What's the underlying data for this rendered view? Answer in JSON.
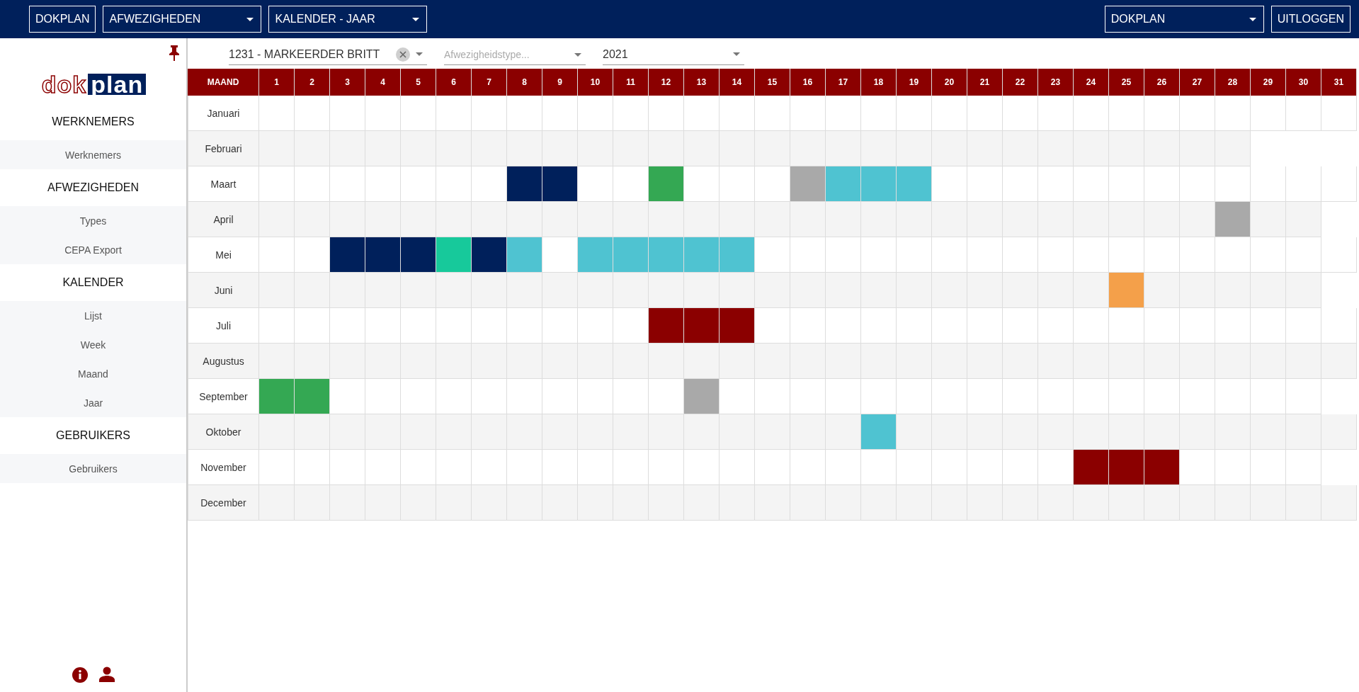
{
  "topbar": {
    "home_button": "DOKPLAN",
    "module_select": "AFWEZIGHEDEN",
    "view_select": "KALENDER - JAAR",
    "company_select": "DOKPLAN",
    "logout_button": "UITLOGGEN"
  },
  "sidebar": {
    "logo": {
      "part_1": "dok",
      "part_2": "plan"
    },
    "sections": [
      {
        "title": "WERKNEMERS",
        "items": [
          "Werknemers"
        ]
      },
      {
        "title": "AFWEZIGHEDEN",
        "items": [
          "Types",
          "CEPA Export"
        ]
      },
      {
        "title": "KALENDER",
        "items": [
          "Lijst",
          "Week",
          "Maand",
          "Jaar"
        ]
      },
      {
        "title": "GEBRUIKERS",
        "items": [
          "Gebruikers"
        ]
      }
    ]
  },
  "filters": {
    "employee": "1231 - MARKEERDER BRITT",
    "absence_type": {
      "placeholder": "Afwezigheidstype..."
    },
    "year": "2021"
  },
  "calendar": {
    "columns": [
      "MAAND",
      "1",
      "2",
      "3",
      "4",
      "5",
      "6",
      "7",
      "8",
      "9",
      "10",
      "11",
      "12",
      "13",
      "14",
      "15",
      "16",
      "17",
      "18",
      "19",
      "20",
      "21",
      "22",
      "23",
      "24",
      "25",
      "26",
      "27",
      "28",
      "29",
      "30",
      "31"
    ],
    "months": [
      {
        "name": "Januari",
        "days": [
          {
            "absent": false
          },
          {
            "absent": false
          },
          {
            "absent": false
          },
          {
            "absent": false
          },
          {
            "absent": false
          },
          {
            "absent": false
          },
          {
            "absent": false
          },
          {
            "absent": false
          },
          {
            "absent": false
          },
          {
            "absent": false
          },
          {
            "absent": false
          },
          {
            "absent": false
          },
          {
            "absent": false
          },
          {
            "absent": false
          },
          {
            "absent": false
          },
          {
            "absent": false
          },
          {
            "absent": false
          },
          {
            "absent": false
          },
          {
            "absent": false
          },
          {
            "absent": false
          },
          {
            "absent": false
          },
          {
            "absent": false
          },
          {
            "absent": false
          },
          {
            "absent": false
          },
          {
            "absent": false
          },
          {
            "absent": false
          },
          {
            "absent": false
          },
          {
            "absent": false
          },
          {
            "absent": false
          },
          {
            "absent": false
          },
          {
            "absent": false
          }
        ]
      },
      {
        "name": "Februari",
        "days": [
          {
            "absent": false
          },
          {
            "absent": false
          },
          {
            "absent": false
          },
          {
            "absent": false
          },
          {
            "absent": false
          },
          {
            "absent": false
          },
          {
            "absent": false
          },
          {
            "absent": false
          },
          {
            "absent": false
          },
          {
            "absent": false
          },
          {
            "absent": false
          },
          {
            "absent": false
          },
          {
            "absent": false
          },
          {
            "absent": false
          },
          {
            "absent": false
          },
          {
            "absent": false
          },
          {
            "absent": false
          },
          {
            "absent": false
          },
          {
            "absent": false
          },
          {
            "absent": false
          },
          {
            "absent": false
          },
          {
            "absent": false
          },
          {
            "absent": false
          },
          {
            "absent": false
          },
          {
            "absent": false
          },
          {
            "absent": false
          },
          {
            "absent": false
          },
          {
            "absent": false
          }
        ]
      },
      {
        "name": "Maart",
        "days": [
          {
            "absent": false
          },
          {
            "absent": false
          },
          {
            "absent": false
          },
          {
            "absent": false
          },
          {
            "absent": false
          },
          {
            "absent": false
          },
          {
            "absent": false
          },
          {
            "absent": true,
            "color": "#00205b"
          },
          {
            "absent": true,
            "color": "#00205b"
          },
          {
            "absent": false
          },
          {
            "absent": false
          },
          {
            "absent": true,
            "color": "#34a853"
          },
          {
            "absent": false
          },
          {
            "absent": false
          },
          {
            "absent": false
          },
          {
            "absent": true,
            "color": "#a9a9a9"
          },
          {
            "absent": true,
            "color": "#4fc3d1"
          },
          {
            "absent": true,
            "color": "#4fc3d1"
          },
          {
            "absent": true,
            "color": "#4fc3d1"
          },
          {
            "absent": false
          },
          {
            "absent": false
          },
          {
            "absent": false
          },
          {
            "absent": false
          },
          {
            "absent": false
          },
          {
            "absent": false
          },
          {
            "absent": false
          },
          {
            "absent": false
          },
          {
            "absent": false
          },
          {
            "absent": false
          },
          {
            "absent": false
          },
          {
            "absent": false
          }
        ]
      },
      {
        "name": "April",
        "days": [
          {
            "absent": false
          },
          {
            "absent": false
          },
          {
            "absent": false
          },
          {
            "absent": false
          },
          {
            "absent": false
          },
          {
            "absent": false
          },
          {
            "absent": false
          },
          {
            "absent": false
          },
          {
            "absent": false
          },
          {
            "absent": false
          },
          {
            "absent": false
          },
          {
            "absent": false
          },
          {
            "absent": false
          },
          {
            "absent": false
          },
          {
            "absent": false
          },
          {
            "absent": false
          },
          {
            "absent": false
          },
          {
            "absent": false
          },
          {
            "absent": false
          },
          {
            "absent": false
          },
          {
            "absent": false
          },
          {
            "absent": false
          },
          {
            "absent": false
          },
          {
            "absent": false
          },
          {
            "absent": false
          },
          {
            "absent": false
          },
          {
            "absent": false
          },
          {
            "absent": true,
            "color": "#a9a9a9"
          },
          {
            "absent": false
          },
          {
            "absent": false
          }
        ]
      },
      {
        "name": "Mei",
        "days": [
          {
            "absent": false
          },
          {
            "absent": false
          },
          {
            "absent": true,
            "color": "#00205b"
          },
          {
            "absent": true,
            "color": "#00205b"
          },
          {
            "absent": true,
            "color": "#00205b"
          },
          {
            "absent": true,
            "color": "#17c99b"
          },
          {
            "absent": true,
            "color": "#00205b"
          },
          {
            "absent": true,
            "color": "#4fc3d1"
          },
          {
            "absent": false
          },
          {
            "absent": true,
            "color": "#4fc3d1"
          },
          {
            "absent": true,
            "color": "#4fc3d1"
          },
          {
            "absent": true,
            "color": "#4fc3d1"
          },
          {
            "absent": true,
            "color": "#4fc3d1"
          },
          {
            "absent": true,
            "color": "#4fc3d1"
          },
          {
            "absent": false
          },
          {
            "absent": false
          },
          {
            "absent": false
          },
          {
            "absent": false
          },
          {
            "absent": false
          },
          {
            "absent": false
          },
          {
            "absent": false
          },
          {
            "absent": false
          },
          {
            "absent": false
          },
          {
            "absent": false
          },
          {
            "absent": false
          },
          {
            "absent": false
          },
          {
            "absent": false
          },
          {
            "absent": false
          },
          {
            "absent": false
          },
          {
            "absent": false
          },
          {
            "absent": false
          }
        ]
      },
      {
        "name": "Juni",
        "days": [
          {
            "absent": false
          },
          {
            "absent": false
          },
          {
            "absent": false
          },
          {
            "absent": false
          },
          {
            "absent": false
          },
          {
            "absent": false
          },
          {
            "absent": false
          },
          {
            "absent": false
          },
          {
            "absent": false
          },
          {
            "absent": false
          },
          {
            "absent": false
          },
          {
            "absent": false
          },
          {
            "absent": false
          },
          {
            "absent": false
          },
          {
            "absent": false
          },
          {
            "absent": false
          },
          {
            "absent": false
          },
          {
            "absent": false
          },
          {
            "absent": false
          },
          {
            "absent": false
          },
          {
            "absent": false
          },
          {
            "absent": false
          },
          {
            "absent": false
          },
          {
            "absent": false
          },
          {
            "absent": true,
            "color": "#f4a04a"
          },
          {
            "absent": false
          },
          {
            "absent": false
          },
          {
            "absent": false
          },
          {
            "absent": false
          },
          {
            "absent": false
          }
        ]
      },
      {
        "name": "Juli",
        "days": [
          {
            "absent": false
          },
          {
            "absent": false
          },
          {
            "absent": false
          },
          {
            "absent": false
          },
          {
            "absent": false
          },
          {
            "absent": false
          },
          {
            "absent": false
          },
          {
            "absent": false
          },
          {
            "absent": false
          },
          {
            "absent": false
          },
          {
            "absent": false
          },
          {
            "absent": true,
            "color": "#8b0000"
          },
          {
            "absent": true,
            "color": "#8b0000"
          },
          {
            "absent": true,
            "color": "#8b0000"
          },
          {
            "absent": false
          },
          {
            "absent": false
          },
          {
            "absent": false
          },
          {
            "absent": false
          },
          {
            "absent": false
          },
          {
            "absent": false
          },
          {
            "absent": false
          },
          {
            "absent": false
          },
          {
            "absent": false
          },
          {
            "absent": false
          },
          {
            "absent": false
          },
          {
            "absent": false
          },
          {
            "absent": false
          },
          {
            "absent": false
          },
          {
            "absent": false
          },
          {
            "absent": false
          },
          {
            "absent": false
          }
        ]
      },
      {
        "name": "Augustus",
        "days": [
          {
            "absent": false
          },
          {
            "absent": false
          },
          {
            "absent": false
          },
          {
            "absent": false
          },
          {
            "absent": false
          },
          {
            "absent": false
          },
          {
            "absent": false
          },
          {
            "absent": false
          },
          {
            "absent": false
          },
          {
            "absent": false
          },
          {
            "absent": false
          },
          {
            "absent": false
          },
          {
            "absent": false
          },
          {
            "absent": false
          },
          {
            "absent": false
          },
          {
            "absent": false
          },
          {
            "absent": false
          },
          {
            "absent": false
          },
          {
            "absent": false
          },
          {
            "absent": false
          },
          {
            "absent": false
          },
          {
            "absent": false
          },
          {
            "absent": false
          },
          {
            "absent": false
          },
          {
            "absent": false
          },
          {
            "absent": false
          },
          {
            "absent": false
          },
          {
            "absent": false
          },
          {
            "absent": false
          },
          {
            "absent": false
          },
          {
            "absent": false
          }
        ]
      },
      {
        "name": "September",
        "days": [
          {
            "absent": true,
            "color": "#34a853"
          },
          {
            "absent": true,
            "color": "#34a853"
          },
          {
            "absent": false
          },
          {
            "absent": false
          },
          {
            "absent": false
          },
          {
            "absent": false
          },
          {
            "absent": false
          },
          {
            "absent": false
          },
          {
            "absent": false
          },
          {
            "absent": false
          },
          {
            "absent": false
          },
          {
            "absent": false
          },
          {
            "absent": true,
            "color": "#a9a9a9"
          },
          {
            "absent": false
          },
          {
            "absent": false
          },
          {
            "absent": false
          },
          {
            "absent": false
          },
          {
            "absent": false
          },
          {
            "absent": false
          },
          {
            "absent": false
          },
          {
            "absent": false
          },
          {
            "absent": false
          },
          {
            "absent": false
          },
          {
            "absent": false
          },
          {
            "absent": false
          },
          {
            "absent": false
          },
          {
            "absent": false
          },
          {
            "absent": false
          },
          {
            "absent": false
          },
          {
            "absent": false
          }
        ]
      },
      {
        "name": "Oktober",
        "days": [
          {
            "absent": false
          },
          {
            "absent": false
          },
          {
            "absent": false
          },
          {
            "absent": false
          },
          {
            "absent": false
          },
          {
            "absent": false
          },
          {
            "absent": false
          },
          {
            "absent": false
          },
          {
            "absent": false
          },
          {
            "absent": false
          },
          {
            "absent": false
          },
          {
            "absent": false
          },
          {
            "absent": false
          },
          {
            "absent": false
          },
          {
            "absent": false
          },
          {
            "absent": false
          },
          {
            "absent": false
          },
          {
            "absent": true,
            "color": "#4fc3d1"
          },
          {
            "absent": false
          },
          {
            "absent": false
          },
          {
            "absent": false
          },
          {
            "absent": false
          },
          {
            "absent": false
          },
          {
            "absent": false
          },
          {
            "absent": false
          },
          {
            "absent": false
          },
          {
            "absent": false
          },
          {
            "absent": false
          },
          {
            "absent": false
          },
          {
            "absent": false
          },
          {
            "absent": false
          }
        ]
      },
      {
        "name": "November",
        "days": [
          {
            "absent": false
          },
          {
            "absent": false
          },
          {
            "absent": false
          },
          {
            "absent": false
          },
          {
            "absent": false
          },
          {
            "absent": false
          },
          {
            "absent": false
          },
          {
            "absent": false
          },
          {
            "absent": false
          },
          {
            "absent": false
          },
          {
            "absent": false
          },
          {
            "absent": false
          },
          {
            "absent": false
          },
          {
            "absent": false
          },
          {
            "absent": false
          },
          {
            "absent": false
          },
          {
            "absent": false
          },
          {
            "absent": false
          },
          {
            "absent": false
          },
          {
            "absent": false
          },
          {
            "absent": false
          },
          {
            "absent": false
          },
          {
            "absent": false
          },
          {
            "absent": true,
            "color": "#8b0000"
          },
          {
            "absent": true,
            "color": "#8b0000"
          },
          {
            "absent": true,
            "color": "#8b0000"
          },
          {
            "absent": false
          },
          {
            "absent": false
          },
          {
            "absent": false
          },
          {
            "absent": false
          }
        ]
      },
      {
        "name": "December",
        "days": [
          {
            "absent": false
          },
          {
            "absent": false
          },
          {
            "absent": false
          },
          {
            "absent": false
          },
          {
            "absent": false
          },
          {
            "absent": false
          },
          {
            "absent": false
          },
          {
            "absent": false
          },
          {
            "absent": false
          },
          {
            "absent": false
          },
          {
            "absent": false
          },
          {
            "absent": false
          },
          {
            "absent": false
          },
          {
            "absent": false
          },
          {
            "absent": false
          },
          {
            "absent": false
          },
          {
            "absent": false
          },
          {
            "absent": false
          },
          {
            "absent": false
          },
          {
            "absent": false
          },
          {
            "absent": false
          },
          {
            "absent": false
          },
          {
            "absent": false
          },
          {
            "absent": false
          },
          {
            "absent": false
          },
          {
            "absent": false
          },
          {
            "absent": false
          },
          {
            "absent": false
          },
          {
            "absent": false
          },
          {
            "absent": false
          },
          {
            "absent": false
          }
        ]
      }
    ]
  }
}
